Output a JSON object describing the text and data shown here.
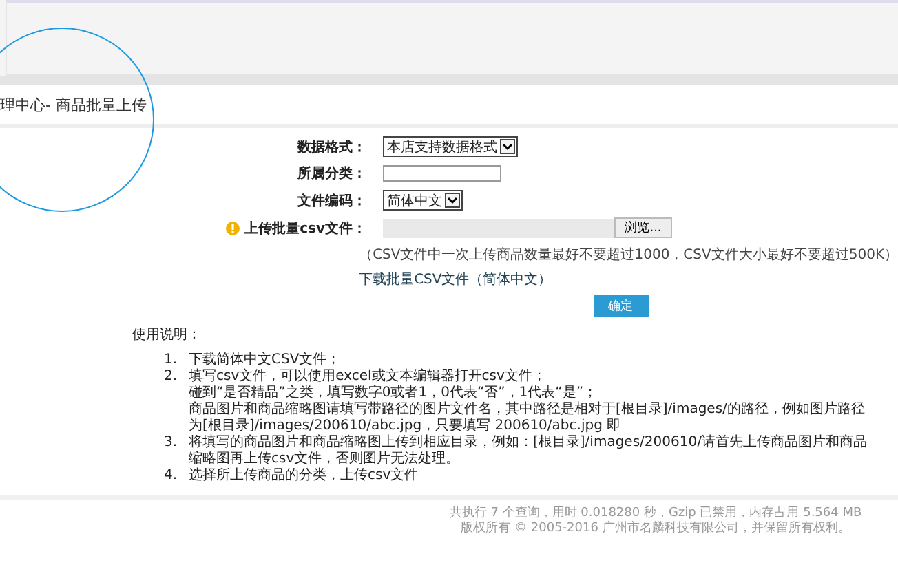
{
  "page_title": "理中心- 商品批量上传",
  "form": {
    "rows": [
      {
        "kind": "select",
        "label": "数据格式：",
        "value": "本店支持数据格式"
      },
      {
        "kind": "input",
        "label": "所属分类：",
        "value": ""
      },
      {
        "kind": "select",
        "label": "文件编码：",
        "value": "简体中文"
      },
      {
        "kind": "file",
        "label": "上传批量csv文件：",
        "button": "浏览...",
        "required": true
      }
    ],
    "hint": "（CSV文件中一次上传商品数量最好不要超过1000，CSV文件大小最好不要超过500K）",
    "download_link": "下载批量CSV文件（简体中文）",
    "submit": "确定"
  },
  "instructions": {
    "title": "使用说明：",
    "items": [
      {
        "number": "1.",
        "lines": [
          "下载简体中文CSV文件；"
        ]
      },
      {
        "number": "2.",
        "lines": [
          "填写csv文件，可以使用excel或文本编辑器打开csv文件；",
          "碰到“是否精品”之类，填写数字0或者1，0代表“否”，1代表“是”；",
          "商品图片和商品缩略图请填写带路径的图片文件名，其中路径是相对于[根目录]/images/的路径，例如图片路径为[根目录]/images/200610/abc.jpg，只要填写  200610/abc.jpg 即"
        ]
      },
      {
        "number": "3.",
        "lines": [
          "将填写的商品图片和商品缩略图上传到相应目录，例如：[根目录]/images/200610/请首先上传商品图片和商品缩略图再上传csv文件，否则图片无法处理。"
        ]
      },
      {
        "number": "4.",
        "lines": [
          "选择所上传商品的分类，上传csv文件"
        ]
      }
    ]
  },
  "footer": [
    "共执行 7 个查询，用时 0.018280 秒，Gzip 已禁用，内存占用 5.564 MB",
    "版权所有 © 2005-2016 广州市名麟科技有限公司，并保留所有权利。"
  ]
}
